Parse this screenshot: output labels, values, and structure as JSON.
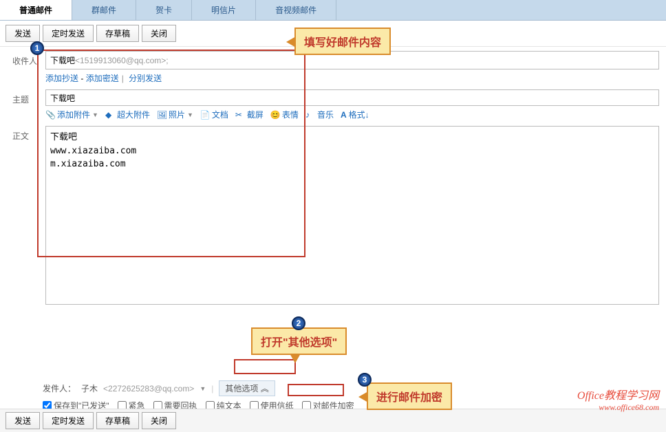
{
  "tabs": [
    "普通邮件",
    "群邮件",
    "贺卡",
    "明信片",
    "音视频邮件"
  ],
  "toolbar": {
    "send": "发送",
    "timed": "定时发送",
    "draft": "存草稿",
    "close": "关闭"
  },
  "labels": {
    "to": "收件人",
    "subject": "主题",
    "body": "正文"
  },
  "recipient": {
    "name": "下载吧",
    "email": "<1519913060@qq.com>;"
  },
  "links": {
    "cc": "添加抄送",
    "bcc": "添加密送",
    "sep": "分别发送"
  },
  "subject": "下载吧",
  "tools": {
    "attach": "添加附件",
    "big": "超大附件",
    "photo": "照片",
    "doc": "文档",
    "screenshot": "截屏",
    "emoji": "表情",
    "music": "音乐",
    "format": "格式↓"
  },
  "body": "下载吧\nwww.xiazaiba.com\nm.xiazaiba.com",
  "sender": {
    "label": "发件人：",
    "name": "子木",
    "email": "<2272625283@qq.com>",
    "other": "其他选项",
    "arrow": "︽"
  },
  "checks": {
    "save": "保存到\"已发送\"",
    "urgent": "紧急",
    "receipt": "需要回执",
    "plain": "纯文本",
    "paper": "使用信纸",
    "encrypt": "对邮件加密"
  },
  "callouts": {
    "c1": "填写好邮件内容",
    "c2": "打开\"其他选项\"",
    "c3": "进行邮件加密"
  },
  "steps": {
    "s1": "1",
    "s2": "2",
    "s3": "3"
  },
  "watermark": {
    "l1": "Office教程学习网",
    "l2": "www.office68.com"
  }
}
